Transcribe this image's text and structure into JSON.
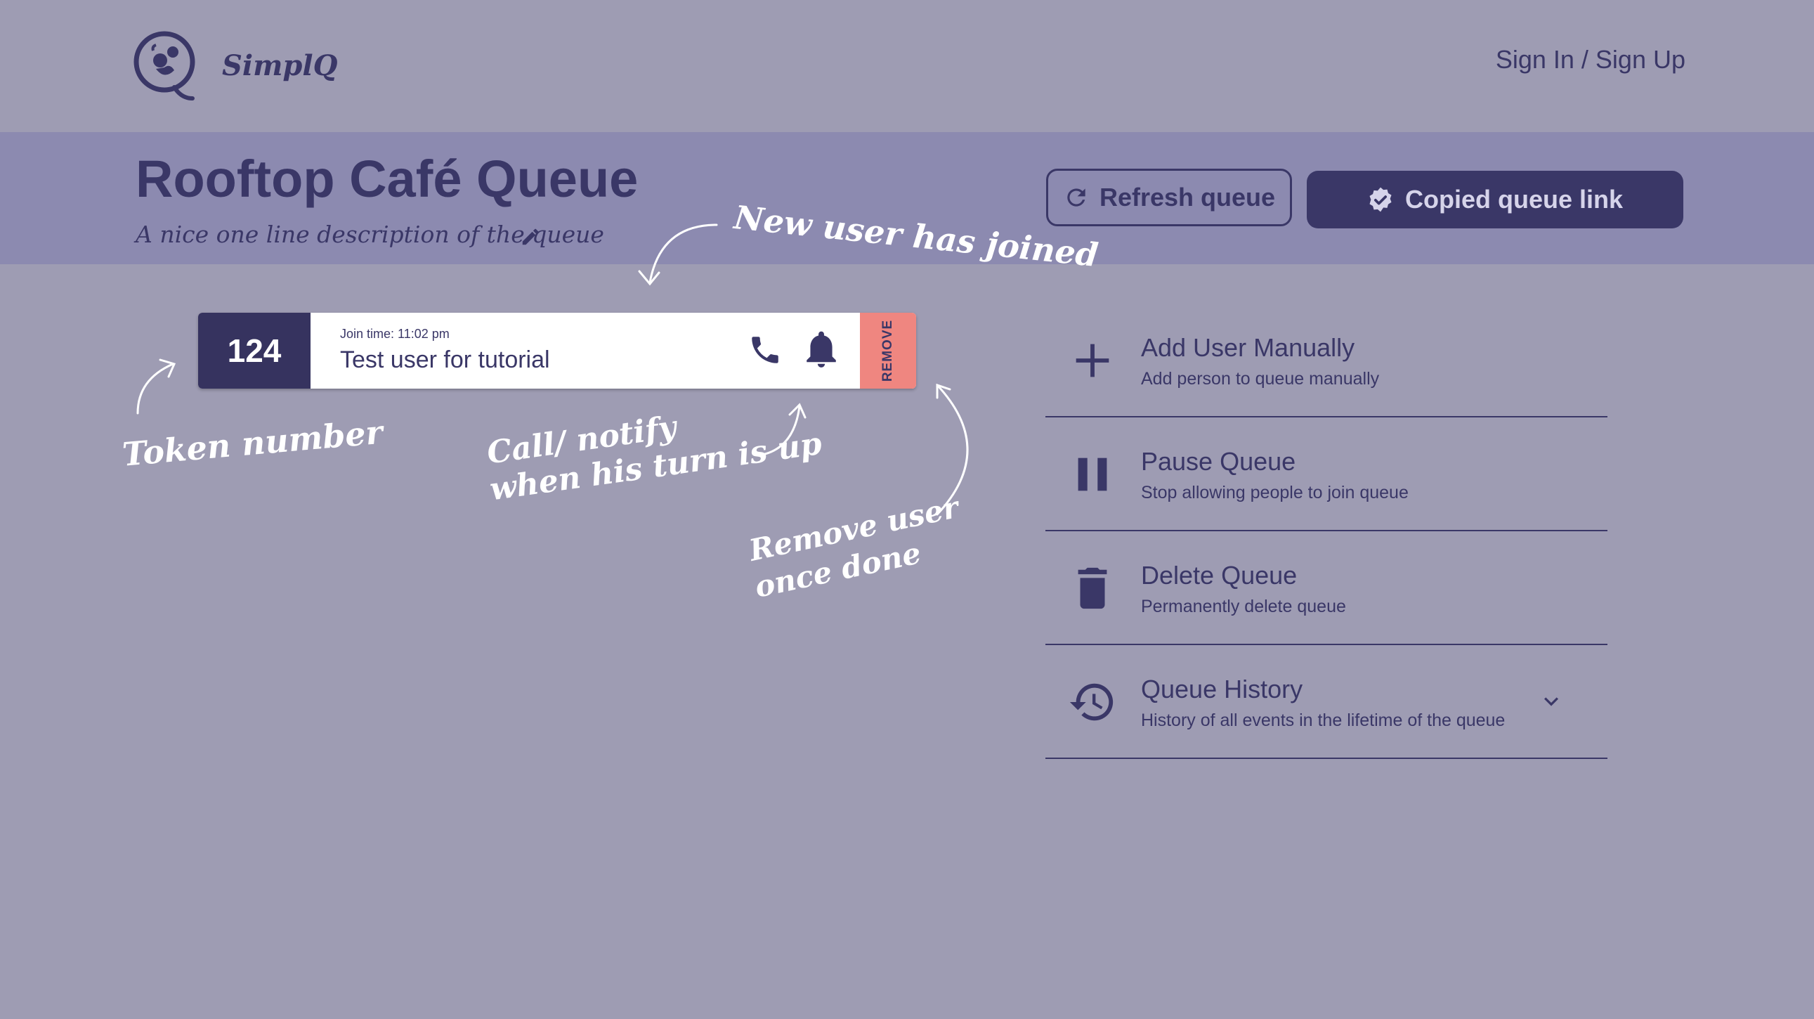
{
  "app": {
    "logo_text": "SimplQ",
    "auth_link": "Sign In / Sign Up"
  },
  "header": {
    "title": "Rooftop Café Queue",
    "description": "A nice one line description of the queue",
    "refresh_label": "Refresh queue",
    "copy_label": "Copied queue link"
  },
  "token_card": {
    "token": "124",
    "join_time": "Join time: 11:02 pm",
    "user_name": "Test user for tutorial",
    "remove_label": "REMOVE"
  },
  "actions": [
    {
      "label": "Add User Manually",
      "sub": "Add person to queue manually",
      "icon": "plus-icon"
    },
    {
      "label": "Pause Queue",
      "sub": "Stop allowing people to join queue",
      "icon": "pause-icon"
    },
    {
      "label": "Delete Queue",
      "sub": "Permanently delete queue",
      "icon": "trash-icon"
    },
    {
      "label": "Queue History",
      "sub": "History of all events in the lifetime of the queue",
      "icon": "history-icon"
    }
  ],
  "annotations": {
    "new_user": "New user has joined",
    "token": "Token number",
    "call_line1": "Call/ notify",
    "call_line2": "when his turn is up",
    "remove_line1": "Remove user",
    "remove_line2": "once done"
  },
  "colors": {
    "background": "#9e9cb3",
    "band": "#8c8ab0",
    "primary": "#3a3767",
    "remove": "#ef8680"
  }
}
